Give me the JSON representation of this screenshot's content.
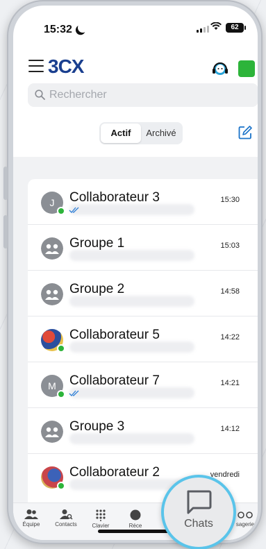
{
  "status_bar": {
    "time": "15:32",
    "battery": "62"
  },
  "header": {
    "logo": "3CX"
  },
  "search": {
    "placeholder": "Rechercher"
  },
  "segments": {
    "active": "Actif",
    "archived": "Archivé"
  },
  "chats": [
    {
      "name": "Collaborateur 3",
      "time": "15:30",
      "avatar": "letter",
      "initial": "J"
    },
    {
      "name": "Groupe 1",
      "time": "15:03",
      "avatar": "group"
    },
    {
      "name": "Groupe 2",
      "time": "14:58",
      "avatar": "group"
    },
    {
      "name": "Collaborateur 5",
      "time": "14:22",
      "avatar": "photo"
    },
    {
      "name": "Collaborateur 7",
      "time": "14:21",
      "avatar": "letter",
      "initial": "M"
    },
    {
      "name": "Groupe 3",
      "time": "14:12",
      "avatar": "group"
    },
    {
      "name": "Collaborateur 2",
      "time": "vendredi",
      "avatar": "photo"
    }
  ],
  "tabbar": {
    "team": "Équipe",
    "contacts": "Contacts",
    "keypad": "Clavier",
    "recents": "Réce",
    "messages": "sagerie"
  },
  "highlight": {
    "label": "Chats"
  },
  "colors": {
    "accent": "#1a3f8f",
    "presence": "#2db43a",
    "highlight_ring": "#5ac4ea"
  }
}
